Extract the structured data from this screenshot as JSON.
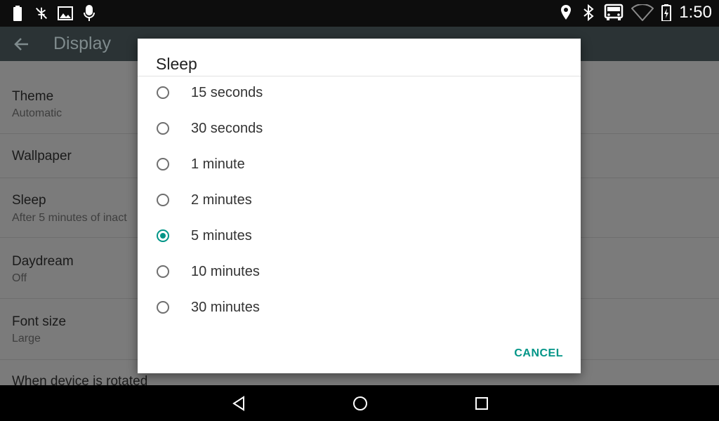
{
  "status_bar": {
    "time": "1:50",
    "left_icons": [
      "battery-icon",
      "usb-debug-icon",
      "image-icon",
      "microphone-icon"
    ],
    "right_icons": [
      "location-icon",
      "bluetooth-icon",
      "car-mode-icon",
      "wifi-icon",
      "battery-charging-icon"
    ]
  },
  "action_bar": {
    "title": "Display"
  },
  "settings_list": {
    "items": [
      {
        "title": "Theme",
        "subtitle": "Automatic"
      },
      {
        "title": "Wallpaper",
        "subtitle": ""
      },
      {
        "title": "Sleep",
        "subtitle": "After 5 minutes of inact"
      },
      {
        "title": "Daydream",
        "subtitle": "Off"
      },
      {
        "title": "Font size",
        "subtitle": "Large"
      },
      {
        "title": "When device is rotated",
        "subtitle": ""
      }
    ]
  },
  "dialog": {
    "title": "Sleep",
    "options": [
      {
        "label": "15 seconds",
        "checked": false
      },
      {
        "label": "30 seconds",
        "checked": false
      },
      {
        "label": "1 minute",
        "checked": false
      },
      {
        "label": "2 minutes",
        "checked": false
      },
      {
        "label": "5 minutes",
        "checked": true
      },
      {
        "label": "10 minutes",
        "checked": false
      },
      {
        "label": "30 minutes",
        "checked": false
      }
    ],
    "cancel_label": "CANCEL",
    "accent_color": "#009587"
  },
  "nav_bar": {
    "buttons": [
      "back-icon",
      "home-icon",
      "recents-icon"
    ]
  }
}
